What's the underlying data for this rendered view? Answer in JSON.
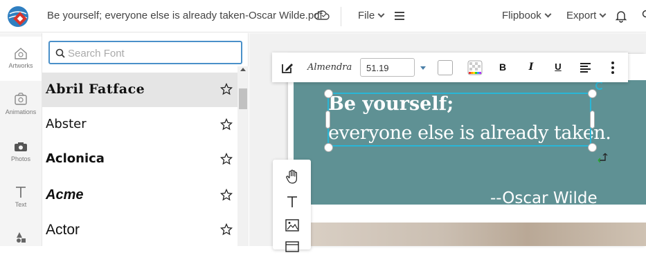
{
  "header": {
    "doc_title": "Be yourself; everyone else is already taken-Oscar Wilde.pdf",
    "file_label": "File",
    "flipbook_label": "Flipbook",
    "export_label": "Export"
  },
  "leftnav": {
    "items": [
      {
        "label": "Artworks",
        "icon": "artworks-icon"
      },
      {
        "label": "Animations",
        "icon": "animations-icon"
      },
      {
        "label": "Photos",
        "icon": "camera-icon"
      },
      {
        "label": "Text",
        "icon": "text-icon"
      },
      {
        "label": "",
        "icon": "shapes-icon"
      }
    ]
  },
  "font_panel": {
    "search_placeholder": "Search Font",
    "fonts": [
      "Abril Fatface",
      "Abster",
      "Aclonica",
      "Acme",
      "Actor"
    ],
    "selected": "Abril Fatface"
  },
  "toolbar": {
    "font_name": "Almendra",
    "font_size": "51.19",
    "bold_label": "B",
    "italic_label": "I",
    "underline_label": "U"
  },
  "canvas": {
    "quote_line1": "Be yourself;",
    "quote_line2": "everyone else is already taken.",
    "author": "--Oscar Wilde"
  },
  "colors": {
    "accent": "#4a90c9",
    "page_teal": "#5f9194",
    "selection": "#29b6d6"
  }
}
